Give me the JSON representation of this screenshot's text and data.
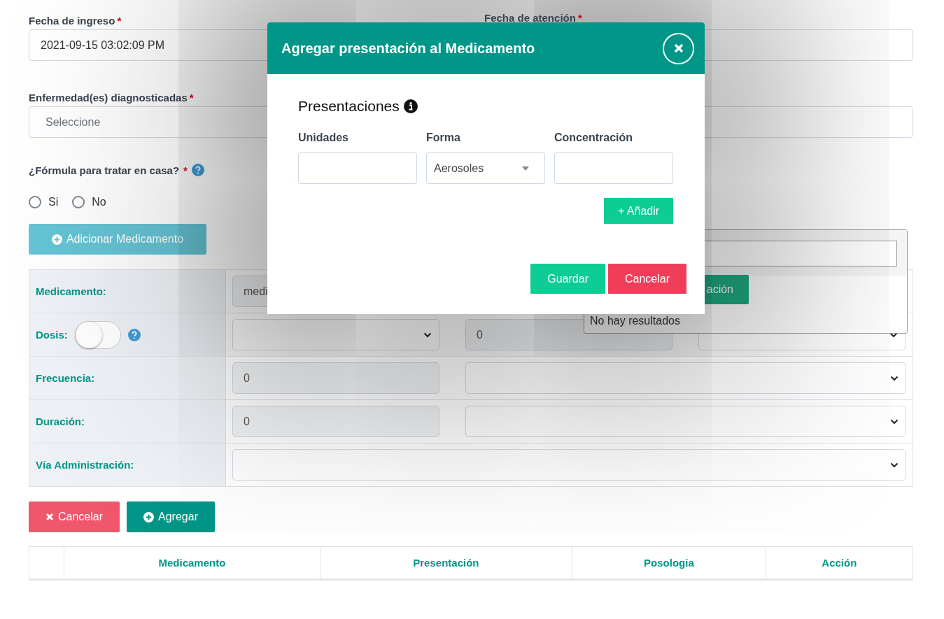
{
  "form": {
    "fields": [
      {
        "label": "Fecha de ingreso",
        "mark": "*",
        "value": "2021-09-15 03:02:09 PM"
      },
      {
        "label": "Fecha de atención",
        "mark": "*"
      },
      {
        "label": "Enfermedad(es) diagnosticadas",
        "mark": "*",
        "placeholder": "Seleccione"
      }
    ],
    "question": {
      "label": "¿Fórmula para tratar en casa?",
      "mark": "*",
      "options": [
        {
          "label": "Si",
          "selected": false
        },
        {
          "label": "No",
          "selected": false
        }
      ]
    },
    "add_button": "Adicionar Medicamento"
  },
  "medication_form": {
    "rows": [
      {
        "label": "Medicamento:",
        "kind": "medicine",
        "value": "medi",
        "button": "ación"
      },
      {
        "label": "Dosis:",
        "kind": "dose",
        "toggle_on": false,
        "amount": "0"
      },
      {
        "label": "Frecuencia:",
        "kind": "number_unit",
        "value": "0"
      },
      {
        "label": "Duración:",
        "kind": "number_unit",
        "value": "0"
      },
      {
        "label": "Vía Administración:",
        "kind": "select"
      }
    ]
  },
  "medicine_dropdown": {
    "no_results": "No hay resultados"
  },
  "actions": [
    {
      "label": "Cancelar",
      "kind": "cancel"
    },
    {
      "label": "Agregar",
      "kind": "add"
    }
  ],
  "list_table": {
    "columns": [
      "Medicamento",
      "Presentación",
      "Posologia",
      "Acción"
    ]
  },
  "modal": {
    "title": "Agregar presentación al Medicamento",
    "section": "Presentaciones",
    "fields": [
      {
        "label": "Unidades",
        "kind": "input"
      },
      {
        "label": "Forma",
        "kind": "select",
        "value": "Aerosoles"
      },
      {
        "label": "Concentración",
        "kind": "input"
      }
    ],
    "add_button": "+ Añadir",
    "buttons": [
      {
        "label": "Guardar",
        "kind": "save"
      },
      {
        "label": "Cancelar",
        "kind": "cancel"
      }
    ]
  }
}
